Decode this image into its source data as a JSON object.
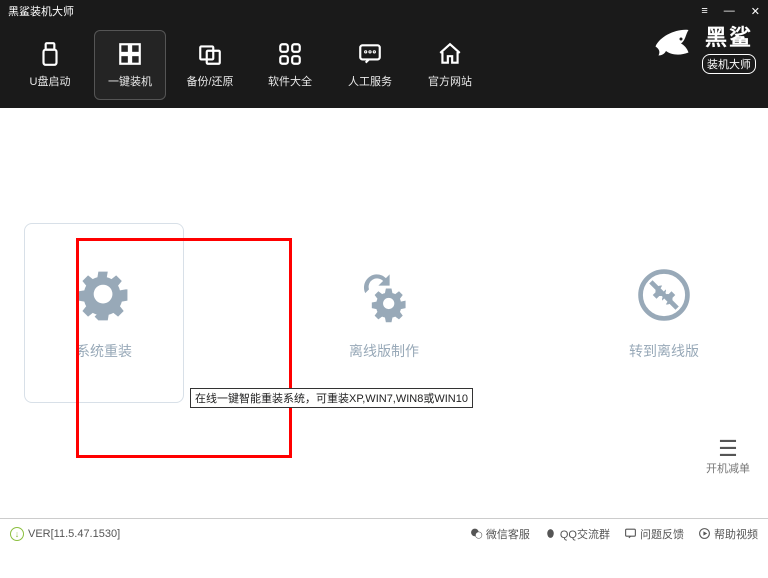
{
  "app": {
    "title": "黑鲨装机大师"
  },
  "nav": {
    "items": [
      {
        "label": "U盘启动"
      },
      {
        "label": "一键装机"
      },
      {
        "label": "备份/还原"
      },
      {
        "label": "软件大全"
      },
      {
        "label": "人工服务"
      },
      {
        "label": "官方网站"
      }
    ],
    "activeIndex": 1
  },
  "brand": {
    "big": "黑鲨",
    "small": "装机大师"
  },
  "main": {
    "options": [
      {
        "label": "系统重装"
      },
      {
        "label": "离线版制作"
      },
      {
        "label": "转到离线版"
      }
    ],
    "tooltip": "在线一键智能重装系统，可重装XP,WIN7,WIN8或WIN10"
  },
  "sidebutton": {
    "label": "开机减单"
  },
  "footer": {
    "version": "VER[11.5.47.1530]",
    "links": [
      {
        "label": "微信客服"
      },
      {
        "label": "QQ交流群"
      },
      {
        "label": "问题反馈"
      },
      {
        "label": "帮助视频"
      }
    ]
  }
}
